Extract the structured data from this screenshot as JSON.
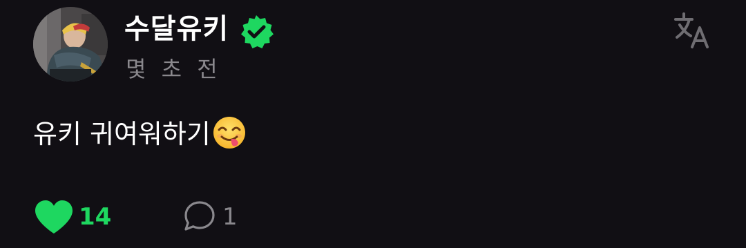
{
  "post": {
    "author": "수달유키",
    "verified": true,
    "timestamp": "몇 초 전",
    "text": "유키 귀여워하기",
    "emoji": "yum-face-emoji",
    "likes": "14",
    "liked": true,
    "comments": "1"
  },
  "icons": {
    "verified": "verified-badge-icon",
    "translate": "translate-icon",
    "like": "heart-icon",
    "comment": "comment-icon"
  },
  "colors": {
    "background": "#110f14",
    "accent": "#1ed760",
    "muted": "#8a888d",
    "text": "#ffffff"
  }
}
